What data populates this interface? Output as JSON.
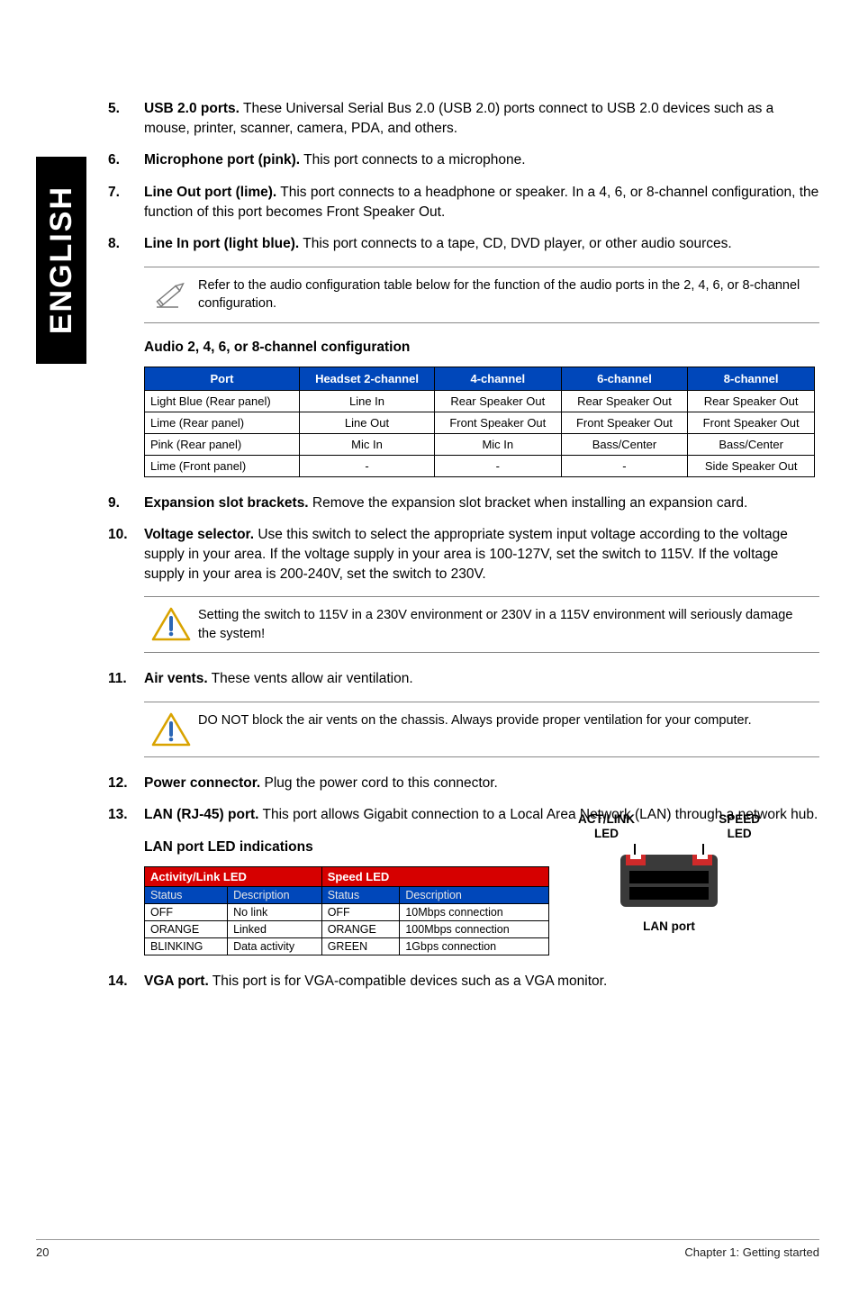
{
  "side_tab": "ENGLISH",
  "items": {
    "i5": {
      "num": "5.",
      "title": "USB 2.0 ports.",
      "text": " These Universal Serial Bus 2.0 (USB 2.0) ports connect to USB 2.0 devices such as a mouse, printer, scanner, camera, PDA, and others."
    },
    "i6": {
      "num": "6.",
      "title": "Microphone port (pink).",
      "text": " This port connects to a microphone."
    },
    "i7": {
      "num": "7.",
      "title": "Line Out port (lime).",
      "text": " This port connects to a headphone or speaker. In a 4, 6, or 8-channel configuration, the function of this port becomes Front Speaker Out."
    },
    "i8": {
      "num": "8.",
      "title": "Line In port (light blue).",
      "text": " This port connects to a tape, CD, DVD player, or other audio sources."
    },
    "i9": {
      "num": "9.",
      "title": "Expansion slot brackets.",
      "text": " Remove the expansion slot bracket when installing an expansion card."
    },
    "i10": {
      "num": "10.",
      "title": "Voltage selector.",
      "text": " Use this switch to select the appropriate system input voltage according to the voltage supply in your area. If the voltage supply in your area is 100-127V, set the switch to 115V. If the voltage supply in your area is 200-240V, set the switch to 230V."
    },
    "i11": {
      "num": "11.",
      "title": "Air vents.",
      "text": " These vents allow air ventilation."
    },
    "i12": {
      "num": "12.",
      "title": "Power connector.",
      "text": " Plug the power cord to this connector."
    },
    "i13": {
      "num": "13.",
      "title": "LAN (RJ-45) port.",
      "text": " This port allows Gigabit connection to a Local Area Network (LAN) through a network hub."
    },
    "i14": {
      "num": "14.",
      "title": "VGA port.",
      "text": " This port is for VGA-compatible devices such as a VGA monitor."
    }
  },
  "note1": "Refer to the audio configuration table below for the function of the audio ports in the 2, 4, 6, or 8-channel configuration.",
  "note2": "Setting the switch to 115V in a 230V environment or 230V in a 115V environment will seriously damage the system!",
  "note3": "DO NOT block the air vents on the chassis. Always provide proper ventilation for your computer.",
  "audio_title": "Audio 2, 4, 6, or 8-channel configuration",
  "audio_table": {
    "headers": [
      "Port",
      "Headset 2-channel",
      "4-channel",
      "6-channel",
      "8-channel"
    ],
    "rows": [
      [
        "Light Blue (Rear panel)",
        "Line In",
        "Rear Speaker Out",
        "Rear Speaker Out",
        "Rear Speaker Out"
      ],
      [
        "Lime (Rear panel)",
        "Line Out",
        "Front Speaker Out",
        "Front Speaker Out",
        "Front Speaker Out"
      ],
      [
        "Pink (Rear panel)",
        "Mic In",
        "Mic In",
        "Bass/Center",
        "Bass/Center"
      ],
      [
        "Lime (Front panel)",
        "-",
        "-",
        "-",
        "Side Speaker Out"
      ]
    ]
  },
  "lan_title": "LAN port LED indications",
  "lan_table": {
    "group_headers": [
      "Activity/Link LED",
      "Speed LED"
    ],
    "sub_headers": [
      "Status",
      "Description",
      "Status",
      "Description"
    ],
    "rows": [
      [
        "OFF",
        "No link",
        "OFF",
        "10Mbps connection"
      ],
      [
        "ORANGE",
        "Linked",
        "ORANGE",
        "100Mbps connection"
      ],
      [
        "BLINKING",
        "Data activity",
        "GREEN",
        "1Gbps connection"
      ]
    ]
  },
  "lan_diag": {
    "left_label": "ACT/LINK\nLED",
    "right_label": "SPEED\nLED",
    "caption": "LAN port"
  },
  "footer": {
    "page": "20",
    "chapter": "Chapter 1: Getting started"
  }
}
